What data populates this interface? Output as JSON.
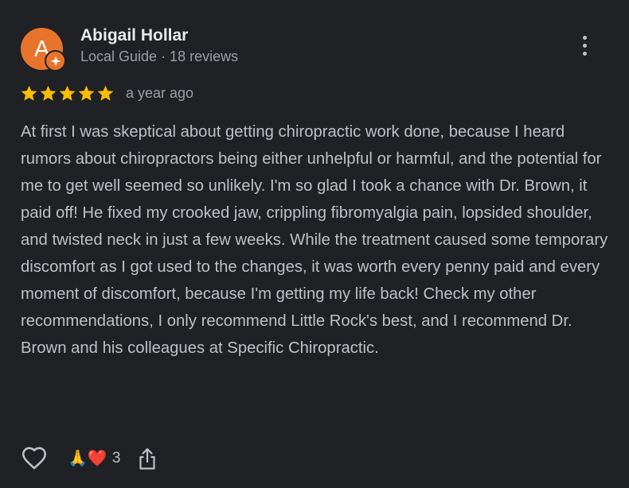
{
  "reviewer": {
    "initial": "A",
    "name": "Abigail Hollar",
    "subtitle": "Local Guide · 18 reviews",
    "avatar_color": "#e8742c"
  },
  "review": {
    "rating": 5,
    "rating_max": 5,
    "star_color": "#fbbc04",
    "time": "a year ago",
    "text": "At first I was skeptical about getting chiropractic work done, because I heard rumors about chiropractors being either unhelpful or harmful, and the potential for me to get well seemed so unlikely. I'm so glad I took a chance with Dr. Brown, it paid off! He fixed my crooked jaw, crippling fibromyalgia pain, lopsided shoulder, and twisted neck in just a few weeks. While the treatment caused some temporary discomfort as I got used to the changes, it was worth every penny paid and every moment of discomfort, because I'm getting my life back! Check my other recommendations, I only recommend Little Rock's best, and I recommend Dr. Brown and his colleagues at Specific Chiropractic."
  },
  "actions": {
    "like_icon": "heart-outline-icon",
    "reactions_emoji": "🙏❤️",
    "reactions_count": "3",
    "share_icon": "share-icon",
    "more_icon": "more-vert-icon"
  }
}
